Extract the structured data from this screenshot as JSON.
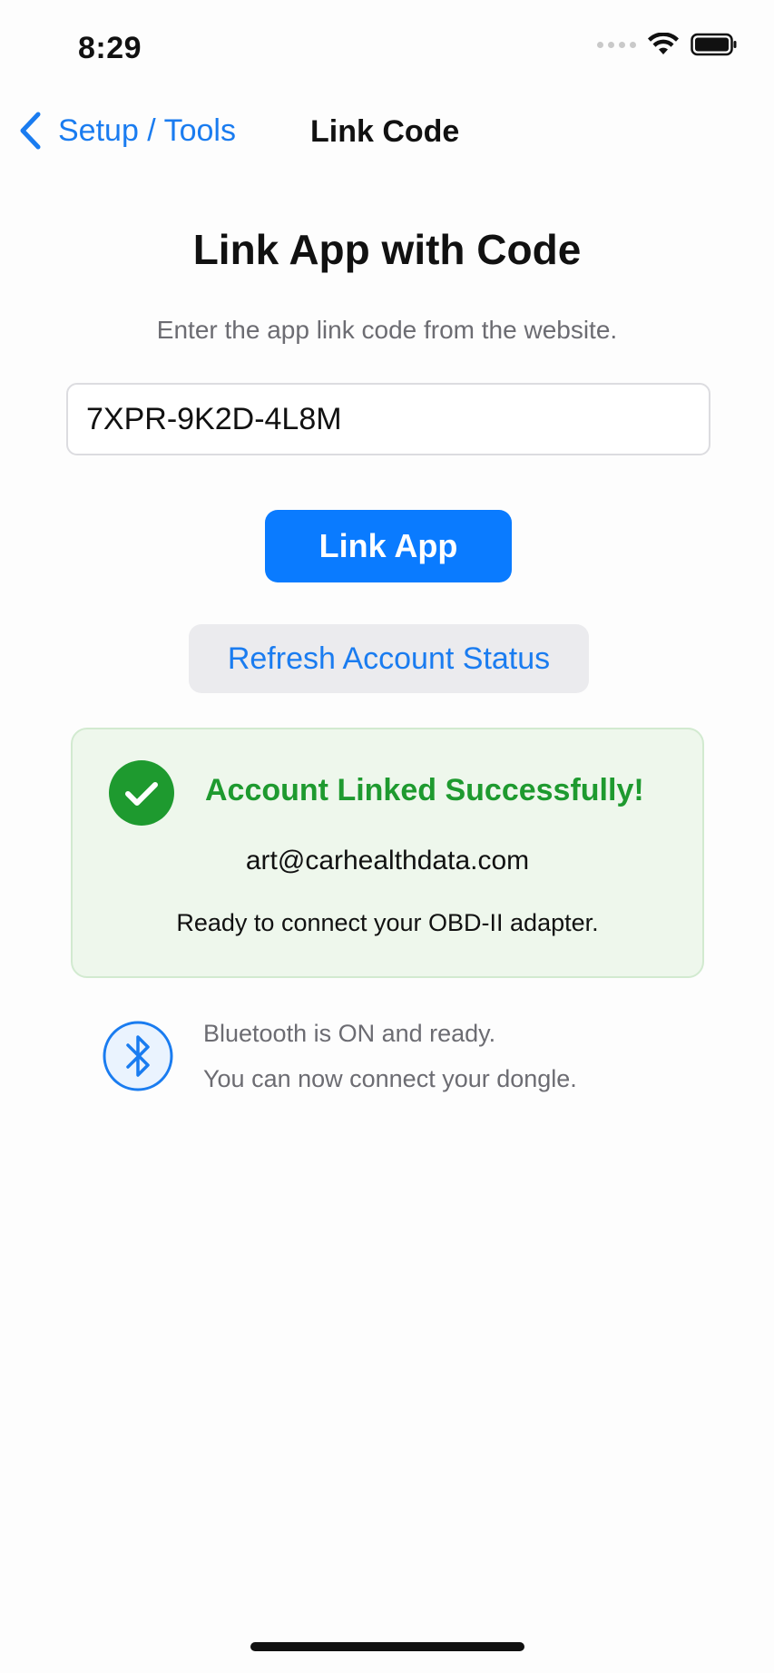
{
  "status_bar": {
    "time": "8:29"
  },
  "nav": {
    "back_label": "Setup / Tools",
    "title": "Link Code"
  },
  "main": {
    "title": "Link App with Code",
    "subtitle": "Enter the app link code from the website.",
    "code_input": {
      "value": "7XPR-9K2D-4L8M",
      "placeholder": ""
    },
    "link_button_label": "Link App",
    "refresh_button_label": "Refresh Account Status"
  },
  "success_card": {
    "heading": "Account Linked Successfully!",
    "email": "art@carhealthdata.com",
    "note": "Ready to connect your OBD-II adapter."
  },
  "bluetooth": {
    "line1": "Bluetooth is ON and ready.",
    "line2": "You can now connect your dongle."
  },
  "colors": {
    "accent": "#0a7bff",
    "link_text": "#1a7cf0",
    "success_green": "#1e9a2f",
    "success_bg": "#eef7ec",
    "secondary_text": "#6c6c72"
  },
  "icons": {
    "back": "chevron-left-icon",
    "success": "checkmark-circle-icon",
    "bluetooth": "bluetooth-icon",
    "wifi": "wifi-icon",
    "battery": "battery-icon",
    "signal": "cellular-signal-icon"
  }
}
